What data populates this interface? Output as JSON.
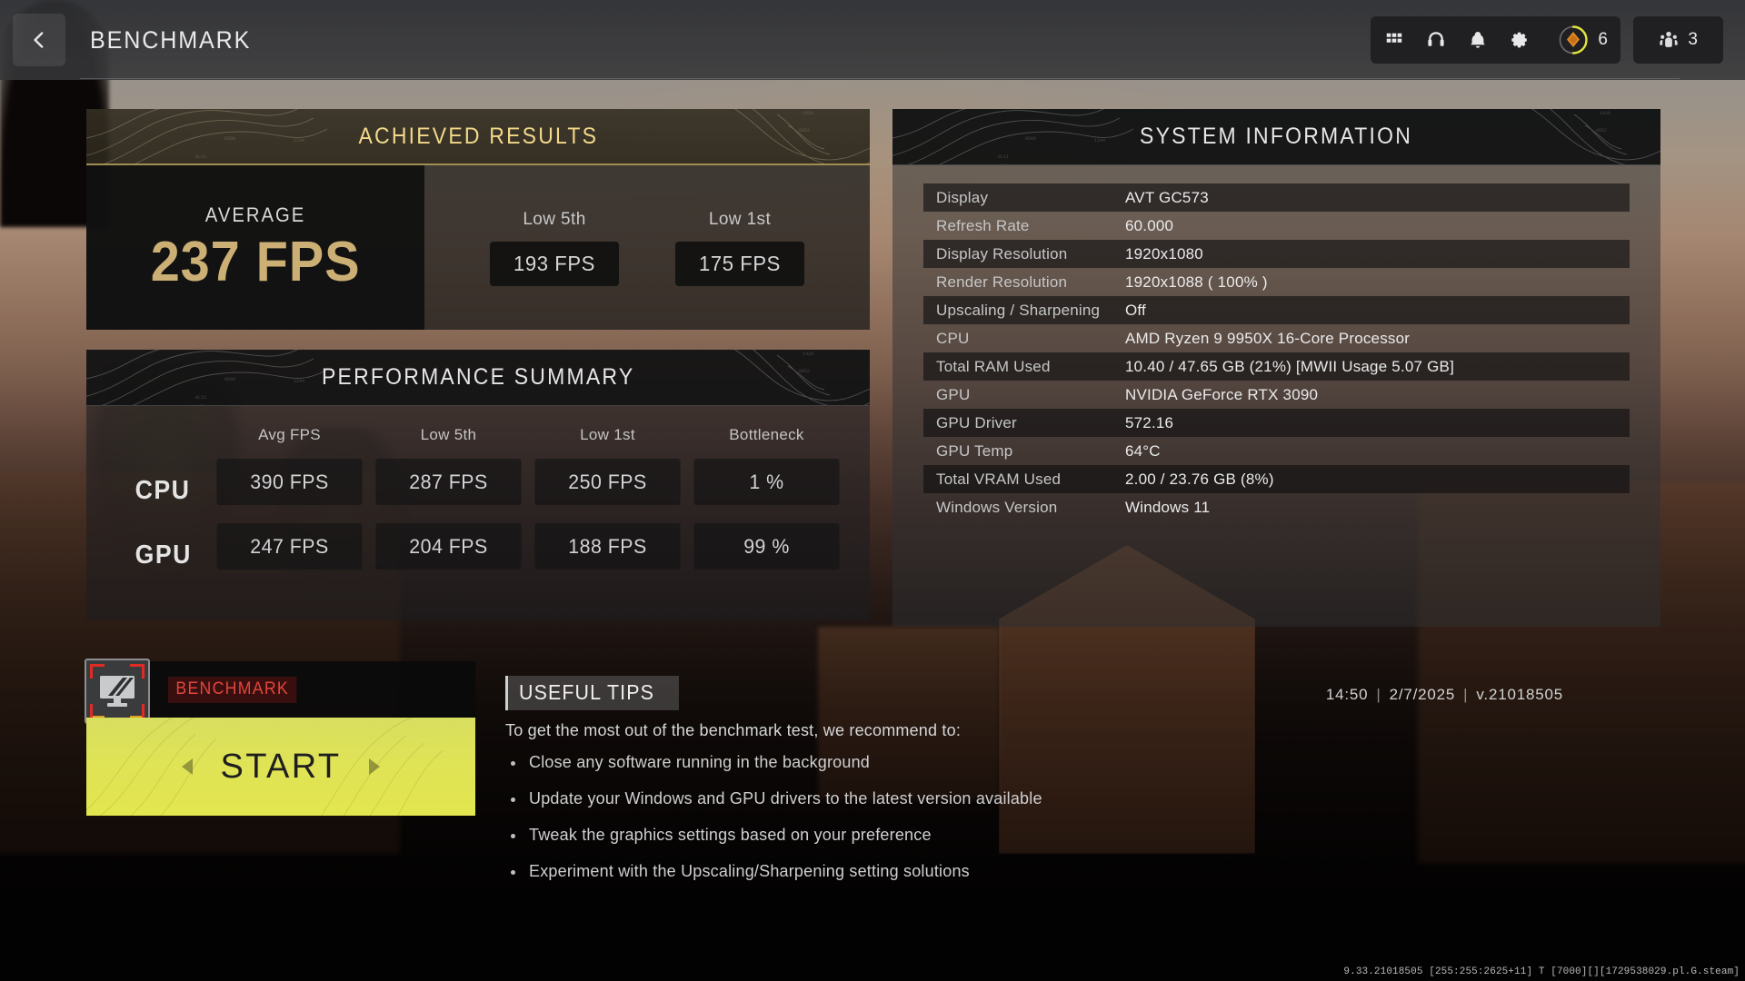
{
  "header": {
    "title": "BENCHMARK",
    "back_icon": "chevron-left-icon",
    "icons": [
      {
        "name": "grid-apps-icon",
        "glyph": "grid"
      },
      {
        "name": "headset-icon",
        "glyph": "headset"
      },
      {
        "name": "notifications-bell-icon",
        "glyph": "bell"
      },
      {
        "name": "settings-gear-icon",
        "glyph": "gear"
      }
    ],
    "currency": {
      "icon": "cod-points-icon",
      "amount": "6"
    },
    "players": {
      "icon": "squad-members-icon",
      "count": "3"
    }
  },
  "achieved_results": {
    "title": "ACHIEVED RESULTS",
    "average_label": "AVERAGE",
    "average_value": "237 FPS",
    "lows": [
      {
        "label": "Low 5th",
        "value": "193 FPS"
      },
      {
        "label": "Low 1st",
        "value": "175 FPS"
      }
    ]
  },
  "performance_summary": {
    "title": "PERFORMANCE SUMMARY",
    "columns": [
      "Avg FPS",
      "Low 5th",
      "Low 1st",
      "Bottleneck"
    ],
    "rows": [
      {
        "label": "CPU",
        "values": [
          "390 FPS",
          "287 FPS",
          "250 FPS",
          "1 %"
        ]
      },
      {
        "label": "GPU",
        "values": [
          "247 FPS",
          "204 FPS",
          "188 FPS",
          "99 %"
        ]
      }
    ]
  },
  "system_information": {
    "title": "SYSTEM INFORMATION",
    "rows": [
      {
        "key": "Display",
        "value": "AVT GC573"
      },
      {
        "key": "Refresh Rate",
        "value": "60.000"
      },
      {
        "key": "Display Resolution",
        "value": "1920x1080"
      },
      {
        "key": "Render Resolution",
        "value": "1920x1088 ( 100% )"
      },
      {
        "key": "Upscaling / Sharpening",
        "value": "Off"
      },
      {
        "key": "CPU",
        "value": "AMD Ryzen 9 9950X 16-Core Processor"
      },
      {
        "key": "Total RAM Used",
        "value": "10.40 / 47.65 GB (21%) [MWII Usage 5.07 GB]"
      },
      {
        "key": "GPU",
        "value": "NVIDIA GeForce RTX 3090"
      },
      {
        "key": "GPU Driver",
        "value": "572.16"
      },
      {
        "key": "GPU Temp",
        "value": "64°C"
      },
      {
        "key": "Total VRAM Used",
        "value": "2.00 / 23.76 GB (8%)"
      },
      {
        "key": "Windows Version",
        "value": "Windows 11"
      }
    ]
  },
  "benchmark_tile": {
    "icon": "benchmark-monitor-icon",
    "label": "BENCHMARK",
    "start_label": "START"
  },
  "useful_tips": {
    "title": "USEFUL TIPS",
    "intro": "To get the most out of the benchmark test, we recommend to:",
    "items": [
      "Close any software running in the background",
      "Update your Windows and GPU drivers to the latest version available",
      "Tweak the graphics settings based on your preference",
      "Experiment with the Upscaling/Sharpening setting solutions"
    ]
  },
  "status_stamp": {
    "time": "14:50",
    "date": "2/7/2025",
    "version": "v.21018505"
  },
  "debug_footer": "9.33.21018505 [255:255:2625+11] T [7000][][1729538029.pl.G.steam]",
  "colors": {
    "accent_gold": "#cbaf74",
    "header_gold": "#f2d98a",
    "start_yellow": "#dfe356",
    "benchmark_red": "#e3453c",
    "text_primary": "#eaeaeb",
    "text_secondary": "#c6c6c7"
  }
}
